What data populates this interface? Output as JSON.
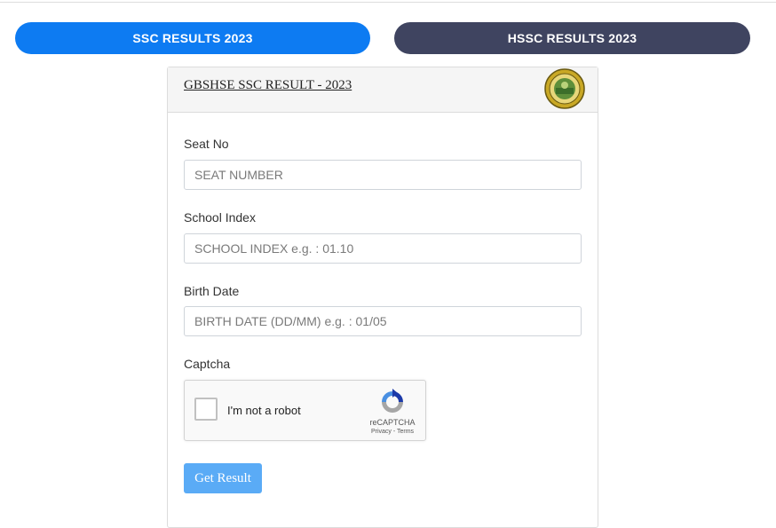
{
  "tabs": {
    "ssc_label": "SSC RESULTS 2023",
    "hssc_label": "HSSC RESULTS 2023"
  },
  "card": {
    "title": "GBSHSE SSC RESULT - 2023"
  },
  "form": {
    "seat_label": "Seat No",
    "seat_placeholder": "SEAT NUMBER",
    "school_label": "School Index",
    "school_placeholder": "SCHOOL INDEX e.g. : 01.10",
    "birth_label": "Birth Date",
    "birth_placeholder": "BIRTH DATE (DD/MM) e.g. : 01/05",
    "captcha_label": "Captcha",
    "submit_label": "Get Result"
  },
  "captcha": {
    "text": "I'm not a robot",
    "brand": "reCAPTCHA",
    "links": "Privacy - Terms"
  },
  "colors": {
    "ssc_tab": "#0d7bf2",
    "hssc_tab": "#3f4460",
    "submit": "#5aabf6"
  },
  "icons": {
    "seal": "board-seal-icon",
    "captcha": "recaptcha-logo-icon"
  }
}
